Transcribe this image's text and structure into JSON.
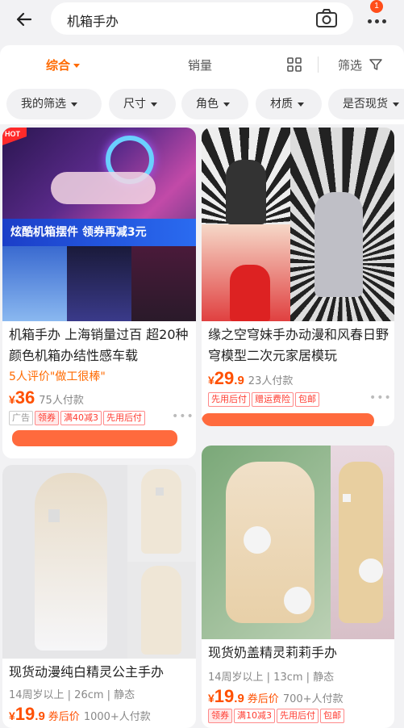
{
  "search": {
    "query": "机箱手办",
    "badge_count": "1"
  },
  "sort": {
    "comprehensive": "综合",
    "sales": "销量",
    "filter": "筛选"
  },
  "chips": [
    "我的筛选",
    "尺寸",
    "角色",
    "材质",
    "是否现货"
  ],
  "products": [
    {
      "banner_text": "炫酷机箱摆件  领券再减3元",
      "hot_label": "HOT",
      "title": "机箱手办 上海销量过百 超20种颜色机箱办结性感车载",
      "review": "5人评价\"做工很棒\"",
      "price_yen": "¥",
      "price_int": "36",
      "price_dec": "",
      "paid": "75人付款",
      "tags": {
        "ad": "广告",
        "coupon": "领券",
        "discount": "满40减3",
        "pay_later": "先用后付"
      }
    },
    {
      "title": "缘之空穹妹手办动漫和风春日野穹模型二次元家居模玩",
      "price_yen": "¥",
      "price_int": "29",
      "price_dec": ".9",
      "paid": "23人付款",
      "tags": {
        "pay_later": "先用后付",
        "insurance": "赠运费险",
        "free_ship": "包邮"
      }
    },
    {
      "title": "现货动漫纯白精灵公主手办",
      "sub": "14周岁以上 | 26cm | 静态",
      "price_yen": "¥",
      "price_int": "19",
      "price_dec": ".9",
      "coupon_after": "券后价",
      "paid": "1000+人付款"
    },
    {
      "title": "现货奶盖精灵莉莉手办",
      "sub": "14周岁以上 | 13cm | 静态",
      "price_yen": "¥",
      "price_int": "19",
      "price_dec": ".9",
      "coupon_after": "券后价",
      "paid": "700+人付款",
      "tags": {
        "coupon": "领券",
        "discount": "满10减3",
        "pay_later": "先用后付",
        "free_ship": "包邮"
      }
    }
  ],
  "colors": {
    "accent": "#ff6a00",
    "price": "#ff5000",
    "tag": "#ff3b30"
  }
}
